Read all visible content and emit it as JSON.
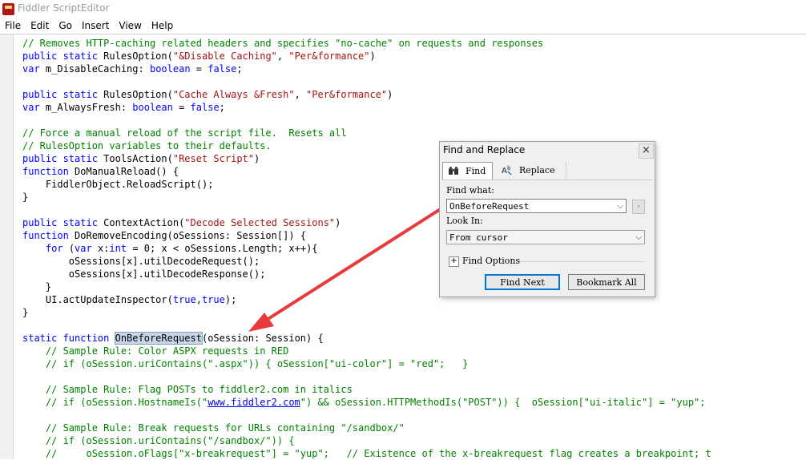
{
  "window": {
    "title": "Fiddler ScriptEditor"
  },
  "menu": [
    "File",
    "Edit",
    "Go",
    "Insert",
    "View",
    "Help"
  ],
  "code": {
    "lines": [
      [
        {
          "t": "// Removes HTTP-caching related headers and specifies \"no-cache\" on requests and responses",
          "c": "c"
        }
      ],
      [
        {
          "t": "public static",
          "c": "k"
        },
        {
          "t": " RulesOption("
        },
        {
          "t": "\"&Disable Caching\"",
          "c": "s"
        },
        {
          "t": ", "
        },
        {
          "t": "\"Per&formance\"",
          "c": "s"
        },
        {
          "t": ")"
        }
      ],
      [
        {
          "t": "var",
          "c": "k"
        },
        {
          "t": " m_DisableCaching: "
        },
        {
          "t": "boolean",
          "c": "k"
        },
        {
          "t": " = "
        },
        {
          "t": "false",
          "c": "k"
        },
        {
          "t": ";"
        }
      ],
      [],
      [
        {
          "t": "public static",
          "c": "k"
        },
        {
          "t": " RulesOption("
        },
        {
          "t": "\"Cache Always &Fresh\"",
          "c": "s"
        },
        {
          "t": ", "
        },
        {
          "t": "\"Per&formance\"",
          "c": "s"
        },
        {
          "t": ")"
        }
      ],
      [
        {
          "t": "var",
          "c": "k"
        },
        {
          "t": " m_AlwaysFresh: "
        },
        {
          "t": "boolean",
          "c": "k"
        },
        {
          "t": " = "
        },
        {
          "t": "false",
          "c": "k"
        },
        {
          "t": ";"
        }
      ],
      [],
      [
        {
          "t": "// Force a manual reload of the script file.  Resets all",
          "c": "c"
        }
      ],
      [
        {
          "t": "// RulesOption variables to their defaults.",
          "c": "c"
        }
      ],
      [
        {
          "t": "public static",
          "c": "k"
        },
        {
          "t": " ToolsAction("
        },
        {
          "t": "\"Reset Script\"",
          "c": "s"
        },
        {
          "t": ")"
        }
      ],
      [
        {
          "t": "function",
          "c": "k"
        },
        {
          "t": " DoManualReload() {"
        }
      ],
      [
        {
          "t": "    FiddlerObject.ReloadScript();"
        }
      ],
      [
        {
          "t": "}"
        }
      ],
      [],
      [
        {
          "t": "public static",
          "c": "k"
        },
        {
          "t": " ContextAction("
        },
        {
          "t": "\"Decode Selected Sessions\"",
          "c": "s"
        },
        {
          "t": ")"
        }
      ],
      [
        {
          "t": "function",
          "c": "k"
        },
        {
          "t": " DoRemoveEncoding(oSessions: Session[]) {"
        }
      ],
      [
        {
          "t": "    "
        },
        {
          "t": "for",
          "c": "k"
        },
        {
          "t": " ("
        },
        {
          "t": "var",
          "c": "k"
        },
        {
          "t": " x:"
        },
        {
          "t": "int",
          "c": "k"
        },
        {
          "t": " = 0; x < oSessions.Length; x++){"
        }
      ],
      [
        {
          "t": "        oSessions[x].utilDecodeRequest();"
        }
      ],
      [
        {
          "t": "        oSessions[x].utilDecodeResponse();"
        }
      ],
      [
        {
          "t": "    }"
        }
      ],
      [
        {
          "t": "    UI.actUpdateInspector("
        },
        {
          "t": "true",
          "c": "k"
        },
        {
          "t": ","
        },
        {
          "t": "true",
          "c": "k"
        },
        {
          "t": ");"
        }
      ],
      [
        {
          "t": "}"
        }
      ],
      [],
      [
        {
          "t": "static function",
          "c": "k"
        },
        {
          "t": " "
        },
        {
          "t": "OnBeforeRequest",
          "c": "hl"
        },
        {
          "t": "(oSession: Session) {"
        }
      ],
      [
        {
          "t": "    // Sample Rule: Color ASPX requests in RED",
          "c": "c"
        }
      ],
      [
        {
          "t": "    // if (oSession.uriContains(\".aspx\")) { oSession[\"ui-color\"] = \"red\";   }",
          "c": "c"
        }
      ],
      [],
      [
        {
          "t": "    // Sample Rule: Flag POSTs to fiddler2.com in italics",
          "c": "c"
        }
      ],
      [
        {
          "t": "    // if (oSession.HostnameIs(\"",
          "c": "c"
        },
        {
          "t": "www.fiddler2.com",
          "c": "link"
        },
        {
          "t": "\") && oSession.HTTPMethodIs(\"POST\")) {  oSession[\"ui-italic\"] = \"yup\";",
          "c": "c"
        }
      ],
      [],
      [
        {
          "t": "    // Sample Rule: Break requests for URLs containing \"/sandbox/\"",
          "c": "c"
        }
      ],
      [
        {
          "t": "    // if (oSession.uriContains(\"/sandbox/\")) {",
          "c": "c"
        }
      ],
      [
        {
          "t": "    //     oSession.oFlags[\"x-breakrequest\"] = \"yup\";   // Existence of the x-breakrequest flag creates a breakpoint; t",
          "c": "c"
        }
      ]
    ]
  },
  "dialog": {
    "title": "Find and Replace",
    "close_glyph": "×",
    "tabs": [
      {
        "label": "Find",
        "icon": "binoculars-icon",
        "active": true
      },
      {
        "label": "Replace",
        "icon": "replace-icon",
        "active": false
      }
    ],
    "find_what_label": "Find what:",
    "find_what_value": "OnBeforeRequest",
    "look_in_label": "Look In:",
    "look_in_value": "From cursor",
    "find_options_label": "Find Options",
    "find_options_toggle": "+",
    "find_next_label": "Find Next",
    "bookmark_all_label": "Bookmark All",
    "dropdown_glyph": "⌵",
    "go_glyph": "›"
  },
  "colors": {
    "comment": "#008000",
    "keyword": "#0000ff",
    "string": "#a31515",
    "arrow": "#e8393b"
  }
}
